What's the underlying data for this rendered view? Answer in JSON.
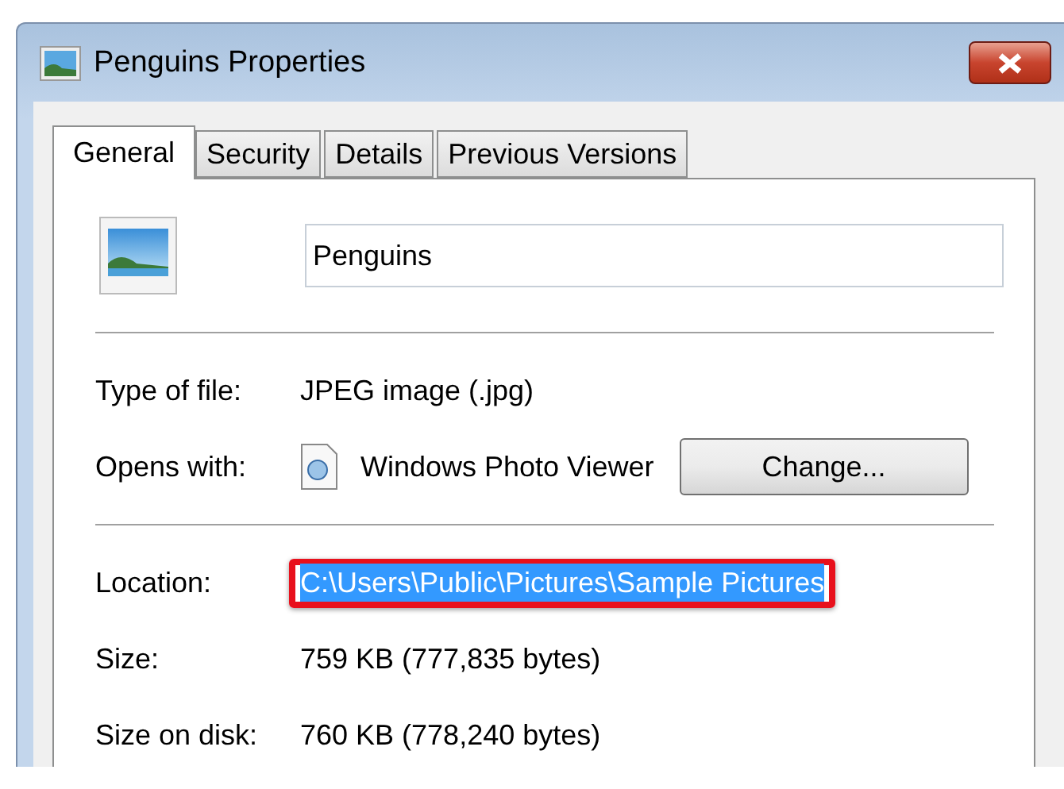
{
  "window": {
    "title": "Penguins Properties"
  },
  "tabs": [
    {
      "label": "General",
      "selected": true
    },
    {
      "label": "Security",
      "selected": false
    },
    {
      "label": "Details",
      "selected": false
    },
    {
      "label": "Previous Versions",
      "selected": false
    }
  ],
  "file_name": "Penguins",
  "sections": [
    {
      "rows": [
        {
          "kind": "text",
          "label": "Type of file:",
          "value": "JPEG image (.jpg)"
        },
        {
          "kind": "app",
          "label": "Opens with:",
          "value": "Windows Photo Viewer",
          "button": "Change..."
        }
      ]
    },
    {
      "rows": [
        {
          "kind": "path",
          "label": "Location:",
          "value": "C:\\Users\\Public\\Pictures\\Sample Pictures",
          "selected": true,
          "highlighted": true
        },
        {
          "kind": "text",
          "label": "Size:",
          "value": "759 KB (777,835 bytes)"
        },
        {
          "kind": "text",
          "label": "Size on disk:",
          "value": "760 KB (778,240 bytes)"
        }
      ]
    }
  ]
}
